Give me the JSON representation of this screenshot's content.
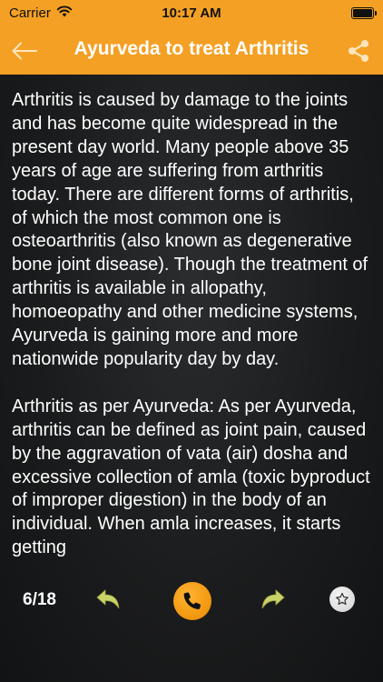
{
  "status_bar": {
    "carrier": "Carrier",
    "time": "10:17 AM",
    "wifi_icon": "wifi-icon",
    "battery_icon": "battery-icon"
  },
  "nav": {
    "title": "Ayurveda to treat Arthritis",
    "back_icon": "back-arrow-icon",
    "share_icon": "share-icon"
  },
  "article": {
    "text": "Arthritis is caused by damage to the joints and has become quite widespread in the present day world. Many people above 35 years of age are suffering from arthritis today. There are different forms of arthritis, of which the most common one is osteoarthritis (also known as degenerative bone joint disease). Though the treatment of arthritis is available in allopathy, homoeopathy and other medicine systems, Ayurveda is gaining more and more nationwide popularity day by day.\n\nArthritis as per Ayurveda: As per Ayurveda, arthritis can be defined as joint pain, caused by the aggravation of vata (air) dosha and excessive collection of amla (toxic byproduct of improper digestion) in the body of an individual. When amla increases, it starts getting"
  },
  "bottom_bar": {
    "page_counter": "6/18",
    "prev_icon": "previous-arrow-icon",
    "call_icon": "phone-icon",
    "next_icon": "next-arrow-icon",
    "favorite_icon": "star-icon"
  },
  "colors": {
    "accent": "#f4a024",
    "background": "#1b1c1d",
    "nav_arrows": "#c9d36a",
    "text": "#ffffff"
  }
}
